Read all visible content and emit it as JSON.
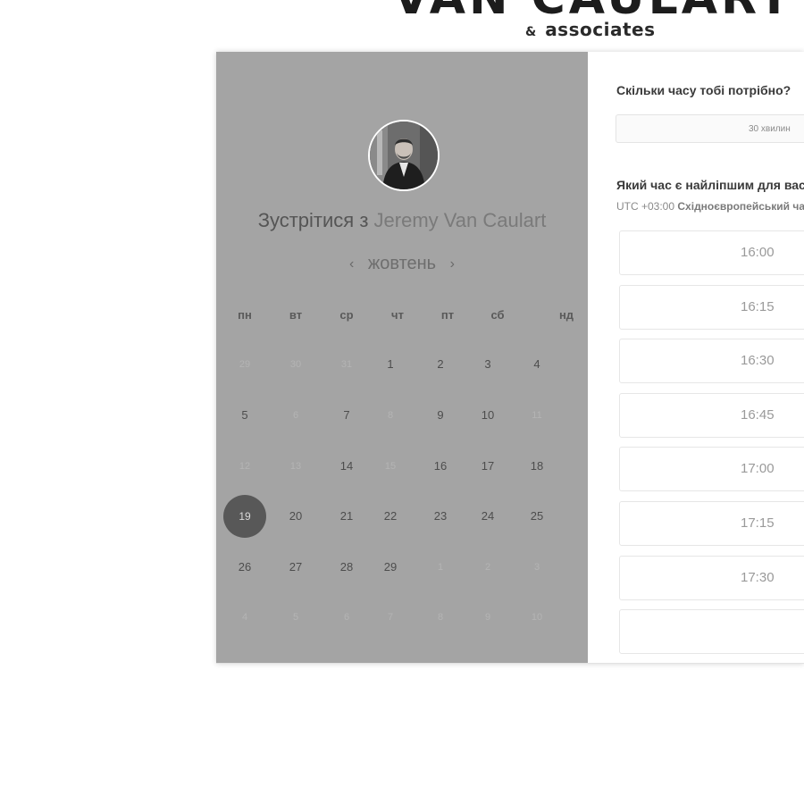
{
  "brand": {
    "top_text": "VAN CAULART",
    "amp": "&",
    "sub_text": "associates"
  },
  "left_panel": {
    "meet_prefix": "Зустрітися з",
    "host_name": "Jeremy Van Caulart",
    "month": "жовтень",
    "prev_glyph": "‹",
    "next_glyph": "›",
    "weekdays": [
      "пн",
      "вт",
      "ср",
      "чт",
      "пт",
      "сб",
      "нд"
    ],
    "days": [
      [
        "29",
        "30",
        "31",
        "1",
        "2",
        "3",
        "4"
      ],
      [
        "5",
        "6",
        "7",
        "8",
        "9",
        "10",
        "11"
      ],
      [
        "12",
        "13",
        "14",
        "15",
        "16",
        "17",
        "18"
      ],
      [
        "19",
        "20",
        "21",
        "22",
        "23",
        "24",
        "25"
      ],
      [
        "26",
        "27",
        "28",
        "29",
        "1",
        "2",
        "3"
      ],
      [
        "4",
        "5",
        "6",
        "7",
        "8",
        "9",
        "10"
      ]
    ],
    "available": [
      [
        false,
        false,
        false,
        true,
        true,
        true,
        true
      ],
      [
        true,
        false,
        true,
        false,
        true,
        true,
        false
      ],
      [
        false,
        false,
        true,
        false,
        true,
        true,
        true
      ],
      [
        true,
        true,
        true,
        true,
        true,
        true,
        true
      ],
      [
        true,
        true,
        true,
        true,
        false,
        false,
        false
      ],
      [
        false,
        false,
        false,
        false,
        false,
        false,
        false
      ]
    ],
    "selected_day": "19",
    "colors": {
      "panel_bg": "#a4a4a4",
      "selected_bg": "#585858"
    }
  },
  "right_panel": {
    "duration_question": "Скільки часу тобі потрібно?",
    "duration_value": "30 хвилин",
    "time_question": "Який час є найліпшим для вас?",
    "timezone_offset": "UTC +03:00",
    "timezone_name": "Східноєвропейський час",
    "slots": [
      "16:00",
      "16:15",
      "16:30",
      "16:45",
      "17:00",
      "17:15",
      "17:30",
      ""
    ]
  }
}
